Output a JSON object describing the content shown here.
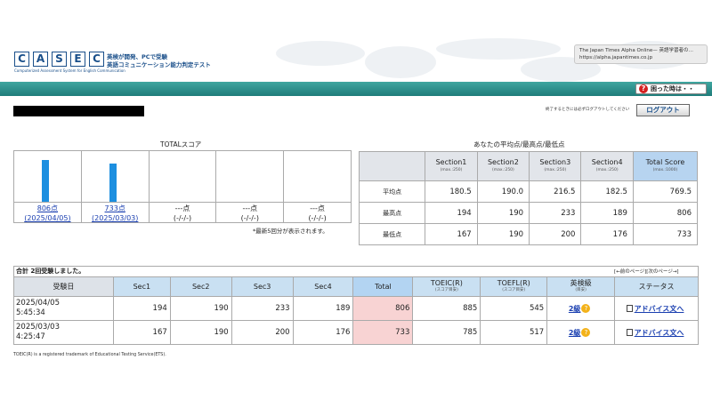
{
  "header": {
    "logo_letters": [
      "C",
      "A",
      "S",
      "E",
      "C"
    ],
    "logo_sub": "Computerized Assessment System for English Communication",
    "tagline_1": "英検が開発、PCで受験",
    "tagline_2": "英語コミュニケーション能力判定テスト",
    "browser_tip_1": "The Japan Times Alpha Online— 英語学習者の…",
    "browser_tip_2": "https://alpha.japantimes.co.jp",
    "help_label": "困った時は・・",
    "help_icon": "?"
  },
  "session": {
    "logout_note": "終了するときには必ずログアウトしてください",
    "logout_label": "ログアウト"
  },
  "total_score": {
    "title": "TOTALスコア",
    "note": "*最新5回分が表示されます。",
    "entries": [
      {
        "score": "806点",
        "date": "(2025/04/05)",
        "value": 806,
        "link": true
      },
      {
        "score": "733点",
        "date": "(2025/03/03)",
        "value": 733,
        "link": true
      },
      {
        "score": "---点",
        "date": "(-/-/-)",
        "value": null,
        "link": false
      },
      {
        "score": "---点",
        "date": "(-/-/-)",
        "value": null,
        "link": false
      },
      {
        "score": "---点",
        "date": "(-/-/-)",
        "value": null,
        "link": false
      }
    ]
  },
  "averages": {
    "title": "あなたの平均点/最高点/最低点",
    "columns": [
      {
        "label": "Section1",
        "max": "(max.:250)"
      },
      {
        "label": "Section2",
        "max": "(max.:250)"
      },
      {
        "label": "Section3",
        "max": "(max.:250)"
      },
      {
        "label": "Section4",
        "max": "(max.:250)"
      },
      {
        "label": "Total Score",
        "max": "(max.:1000)"
      }
    ],
    "rows": [
      {
        "label": "平均点",
        "values": [
          "180.5",
          "190.0",
          "216.5",
          "182.5",
          "769.5"
        ]
      },
      {
        "label": "最高点",
        "values": [
          "194",
          "190",
          "233",
          "189",
          "806"
        ]
      },
      {
        "label": "最低点",
        "values": [
          "167",
          "190",
          "200",
          "176",
          "733"
        ]
      }
    ]
  },
  "history": {
    "summary": "合計 2回受験しました。",
    "nav": "[←前のページ][次のページ→]",
    "headers": [
      {
        "label": "受験日",
        "sub": ""
      },
      {
        "label": "Sec1",
        "sub": ""
      },
      {
        "label": "Sec2",
        "sub": ""
      },
      {
        "label": "Sec3",
        "sub": ""
      },
      {
        "label": "Sec4",
        "sub": ""
      },
      {
        "label": "Total",
        "sub": ""
      },
      {
        "label": "TOEIC(R)",
        "sub": "(スコア目安)"
      },
      {
        "label": "TOEFL(R)",
        "sub": "(スコア目安)"
      },
      {
        "label": "英検級",
        "sub": "(目安)"
      },
      {
        "label": "ステータス",
        "sub": ""
      }
    ],
    "rows": [
      {
        "date": "2025/04/05",
        "time": "5:45:34",
        "sec1": "194",
        "sec2": "190",
        "sec3": "233",
        "sec4": "189",
        "total": "806",
        "toeic": "885",
        "toefl": "545",
        "eiken": "2級",
        "status": "アドバイス文へ"
      },
      {
        "date": "2025/03/03",
        "time": "4:25:47",
        "sec1": "167",
        "sec2": "190",
        "sec3": "200",
        "sec4": "176",
        "total": "733",
        "toeic": "785",
        "toefl": "517",
        "eiken": "2級",
        "status": "アドバイス文へ"
      }
    ]
  },
  "footer": "TOEIC(R) is a registered trademark of Educational Testing Service(ETS).",
  "colors": {
    "bar": "#1d8fe0",
    "teal": "#2a8f8c",
    "total_cell": "#f8d3d3"
  }
}
